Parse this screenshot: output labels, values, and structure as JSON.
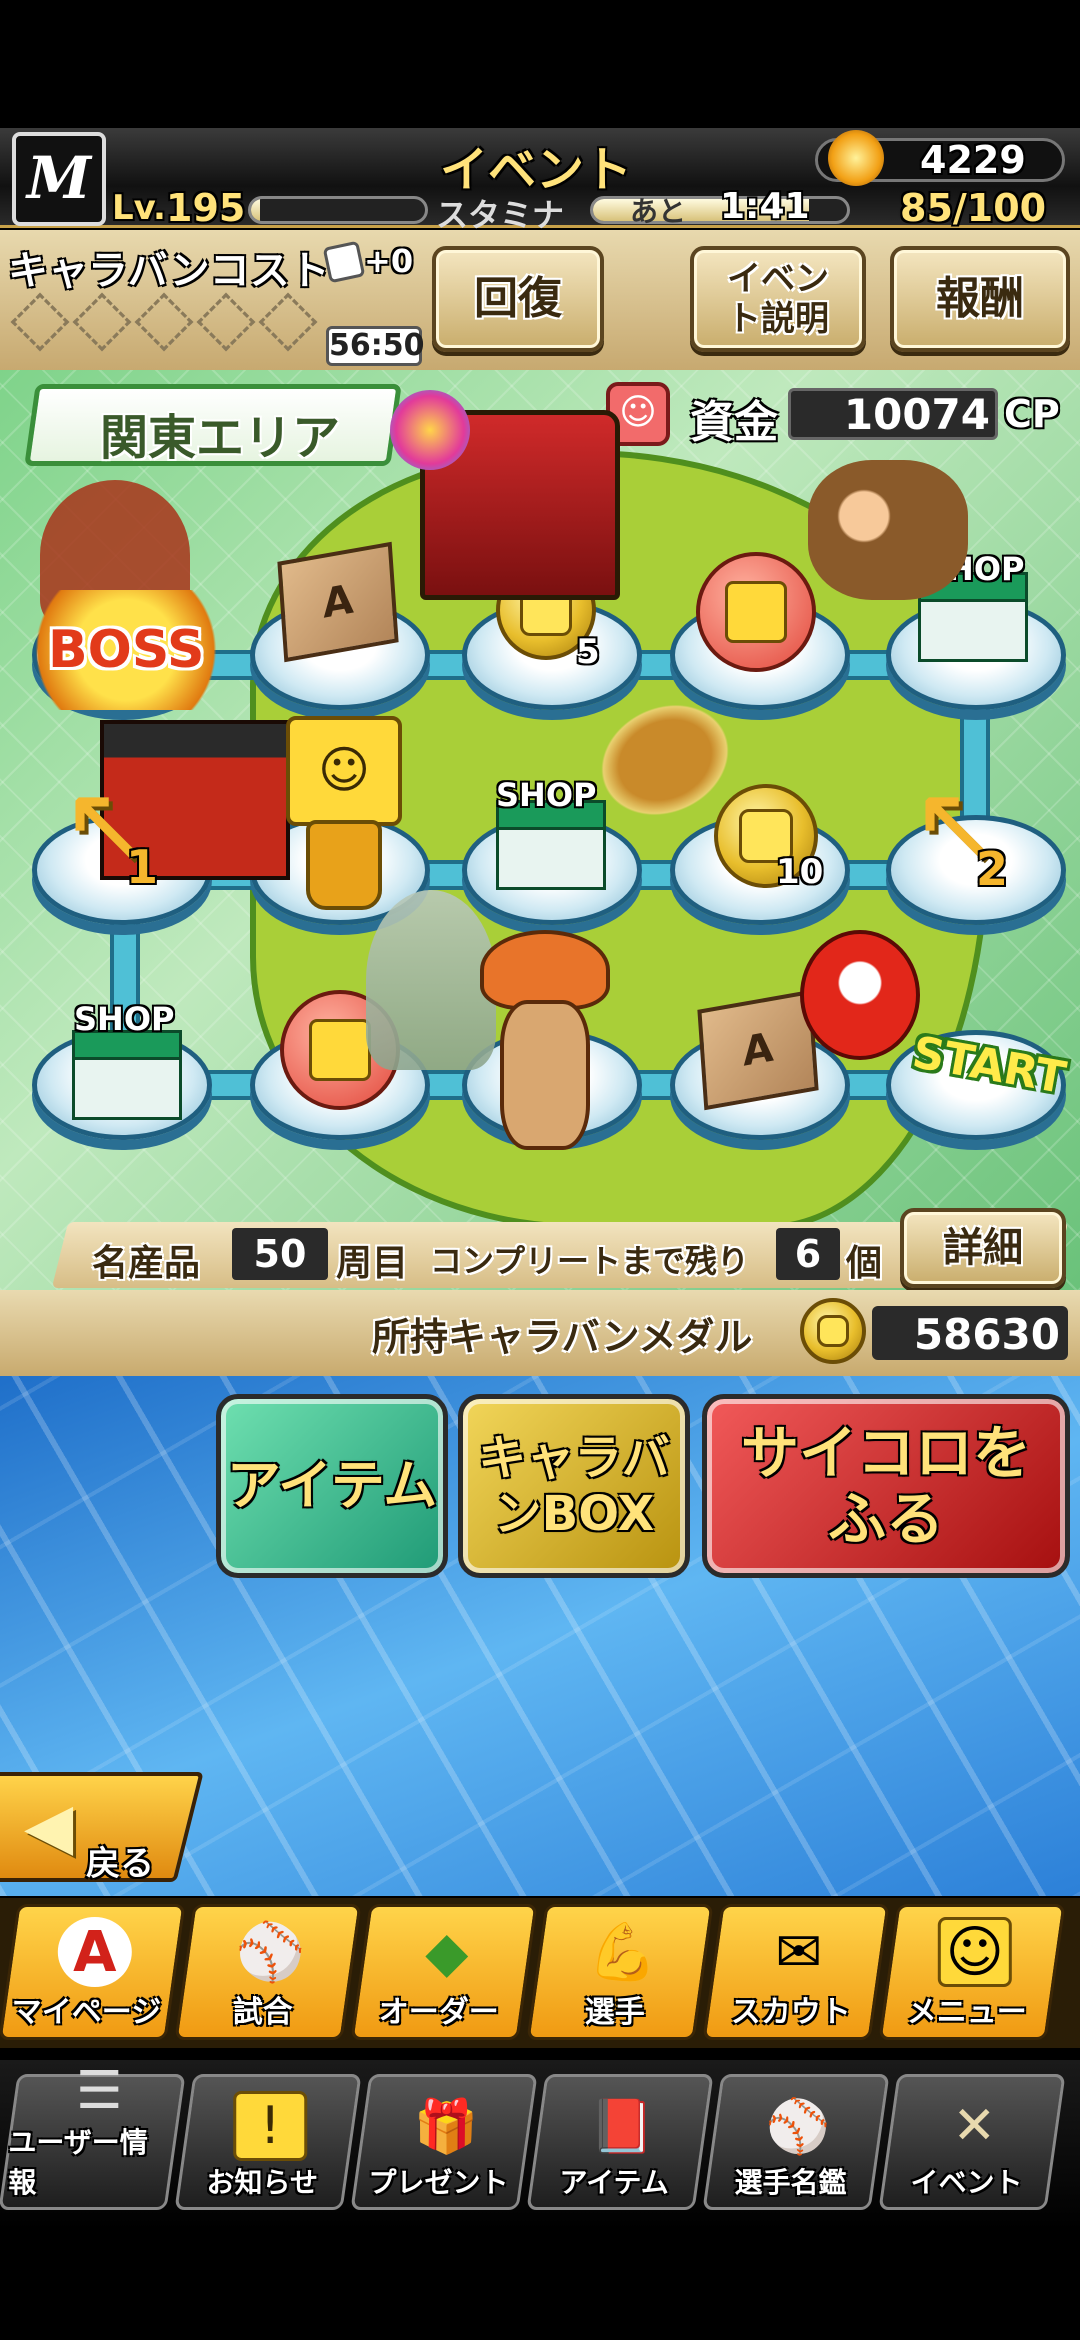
{
  "header": {
    "logo_letter": "M",
    "title": "イベント",
    "currency": "4229",
    "level_label": "Lv.",
    "level": "195",
    "stamina_label": "スタミナ",
    "stamina_timer_prefix": "あと",
    "stamina_timer": "1:41",
    "stamina": "85/100",
    "stamina_fraction": 0.85
  },
  "caravan": {
    "cost_label": "キャラバンコスト",
    "cost_bonus": "+0",
    "cost_timer": "56:50",
    "recover_button": "回復",
    "event_info_button": "イベント説明",
    "reward_button": "報酬"
  },
  "map": {
    "area_name": "関東エリア",
    "funds_label": "資金",
    "funds_value": "10074",
    "funds_unit": "CP",
    "boss_label": "BOSS",
    "shop_label": "SHOP",
    "start_label": "START",
    "coin5": "5",
    "coin10": "10",
    "arrow1": "1",
    "arrow2": "2",
    "box_mark": "A"
  },
  "progress": {
    "specialty_label": "名産品",
    "laps_value": "50",
    "laps_label": "周目",
    "remaining_label": "コンプリートまで残り",
    "remaining_value": "6",
    "remaining_unit": "個",
    "detail_button": "詳細"
  },
  "medals": {
    "label": "所持キャラバンメダル",
    "value": "58630"
  },
  "actions": {
    "item_button": "アイテム",
    "caravan_box_button": "キャラバンBOX",
    "dice_button": "サイコロをふる"
  },
  "back_button": "戻る",
  "nav_primary": [
    {
      "label": "マイページ",
      "icon": "A"
    },
    {
      "label": "試合",
      "icon": "⚾"
    },
    {
      "label": "オーダー",
      "icon": "◆"
    },
    {
      "label": "選手",
      "icon": "💪"
    },
    {
      "label": "スカウト",
      "icon": "✉"
    },
    {
      "label": "メニュー",
      "icon": "☺"
    }
  ],
  "nav_secondary": [
    {
      "label": "ユーザー情報",
      "icon": "☰"
    },
    {
      "label": "お知らせ",
      "icon": "!"
    },
    {
      "label": "プレゼント",
      "icon": "🎁"
    },
    {
      "label": "アイテム",
      "icon": "📕"
    },
    {
      "label": "選手名鑑",
      "icon": "⚾"
    },
    {
      "label": "イベント",
      "icon": "✕"
    }
  ]
}
